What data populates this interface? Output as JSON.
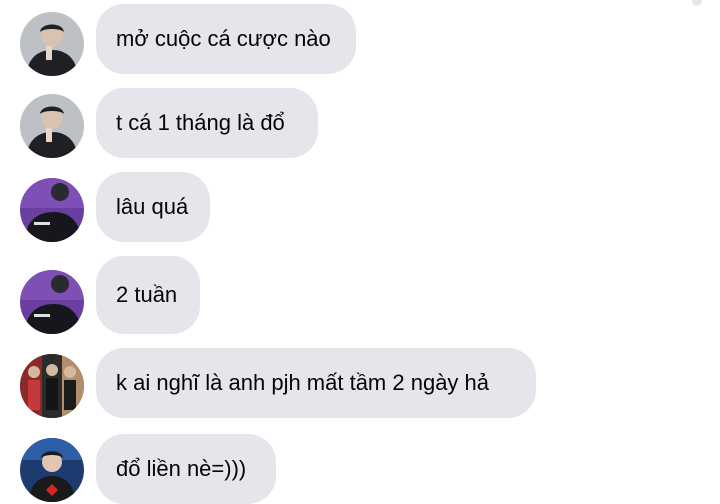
{
  "messages": [
    {
      "avatar": "avatar-dark-jacket",
      "text": "mở cuộc cá cược nào"
    },
    {
      "avatar": "avatar-dark-jacket",
      "text": "t cá 1 tháng là đổ"
    },
    {
      "avatar": "avatar-purple-jacket",
      "text": "lâu quá"
    },
    {
      "avatar": "avatar-purple-jacket",
      "text": "2 tuần"
    },
    {
      "avatar": "avatar-team-group",
      "text": "k ai nghĩ là anh pjh mất tầm 2 ngày hả"
    },
    {
      "avatar": "avatar-blue-stage",
      "text": "đổ liền nè=)))"
    }
  ],
  "colors": {
    "bubble": "#e4e6eb",
    "text": "#050505"
  }
}
